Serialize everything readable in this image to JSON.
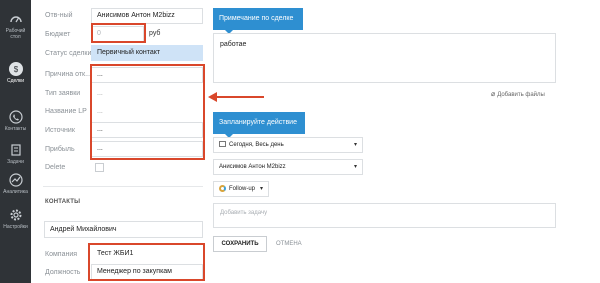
{
  "sidebar": {
    "items": [
      {
        "label": "Рабочий стол",
        "icon": "dashboard-icon"
      },
      {
        "label": "Сделки",
        "icon": "dollar-icon"
      },
      {
        "label": "Контакты",
        "icon": "phone-icon"
      },
      {
        "label": "Задачи",
        "icon": "checklist-icon"
      },
      {
        "label": "Аналитика",
        "icon": "chart-icon"
      },
      {
        "label": "Настройки",
        "icon": "gear-icon"
      }
    ]
  },
  "deal_form": {
    "responsible_label": "Отв-ный",
    "responsible_value": "Анисимов Антон M2bizz",
    "budget_label": "Бюджет",
    "budget_value": "0",
    "budget_unit": "руб",
    "status_label": "Статус сделки",
    "status_value": "Первичный контакт",
    "reason_label": "Причина отк...",
    "reason_value": "...",
    "request_type_label": "Тип заявки",
    "request_type_value": "...",
    "lp_name_label": "Название LP",
    "lp_name_value": "...",
    "source_label": "Источник",
    "source_value": "...",
    "profit_label": "Прибыль",
    "profit_value": "...",
    "delete_label": "Delete"
  },
  "contacts": {
    "section_title": "КОНТАКТЫ",
    "contact_name": "Андрей Михайлович",
    "company_label": "Компания",
    "company_value": "Тест ЖБИ1",
    "position_label": "Должность",
    "position_value": "Менеджер по закупкам"
  },
  "note": {
    "header": "Примечание по сделке",
    "text": "работае",
    "attach_label": "Добавить файлы"
  },
  "task": {
    "header": "Запланируйте действие",
    "date_value": "Сегодня, Весь день",
    "assignee_value": "Анисимов Антон M2bizz",
    "type_value": "Follow-up",
    "task_placeholder": "Добавить задачу",
    "save_label": "СОХРАНИТЬ",
    "cancel_label": "ОТМЕНА"
  },
  "colors": {
    "sidebar_bg": "#2f3337",
    "accent_blue": "#2e8fd1",
    "highlight_red": "#d9472b",
    "status_selected": "#cfe3f7"
  }
}
